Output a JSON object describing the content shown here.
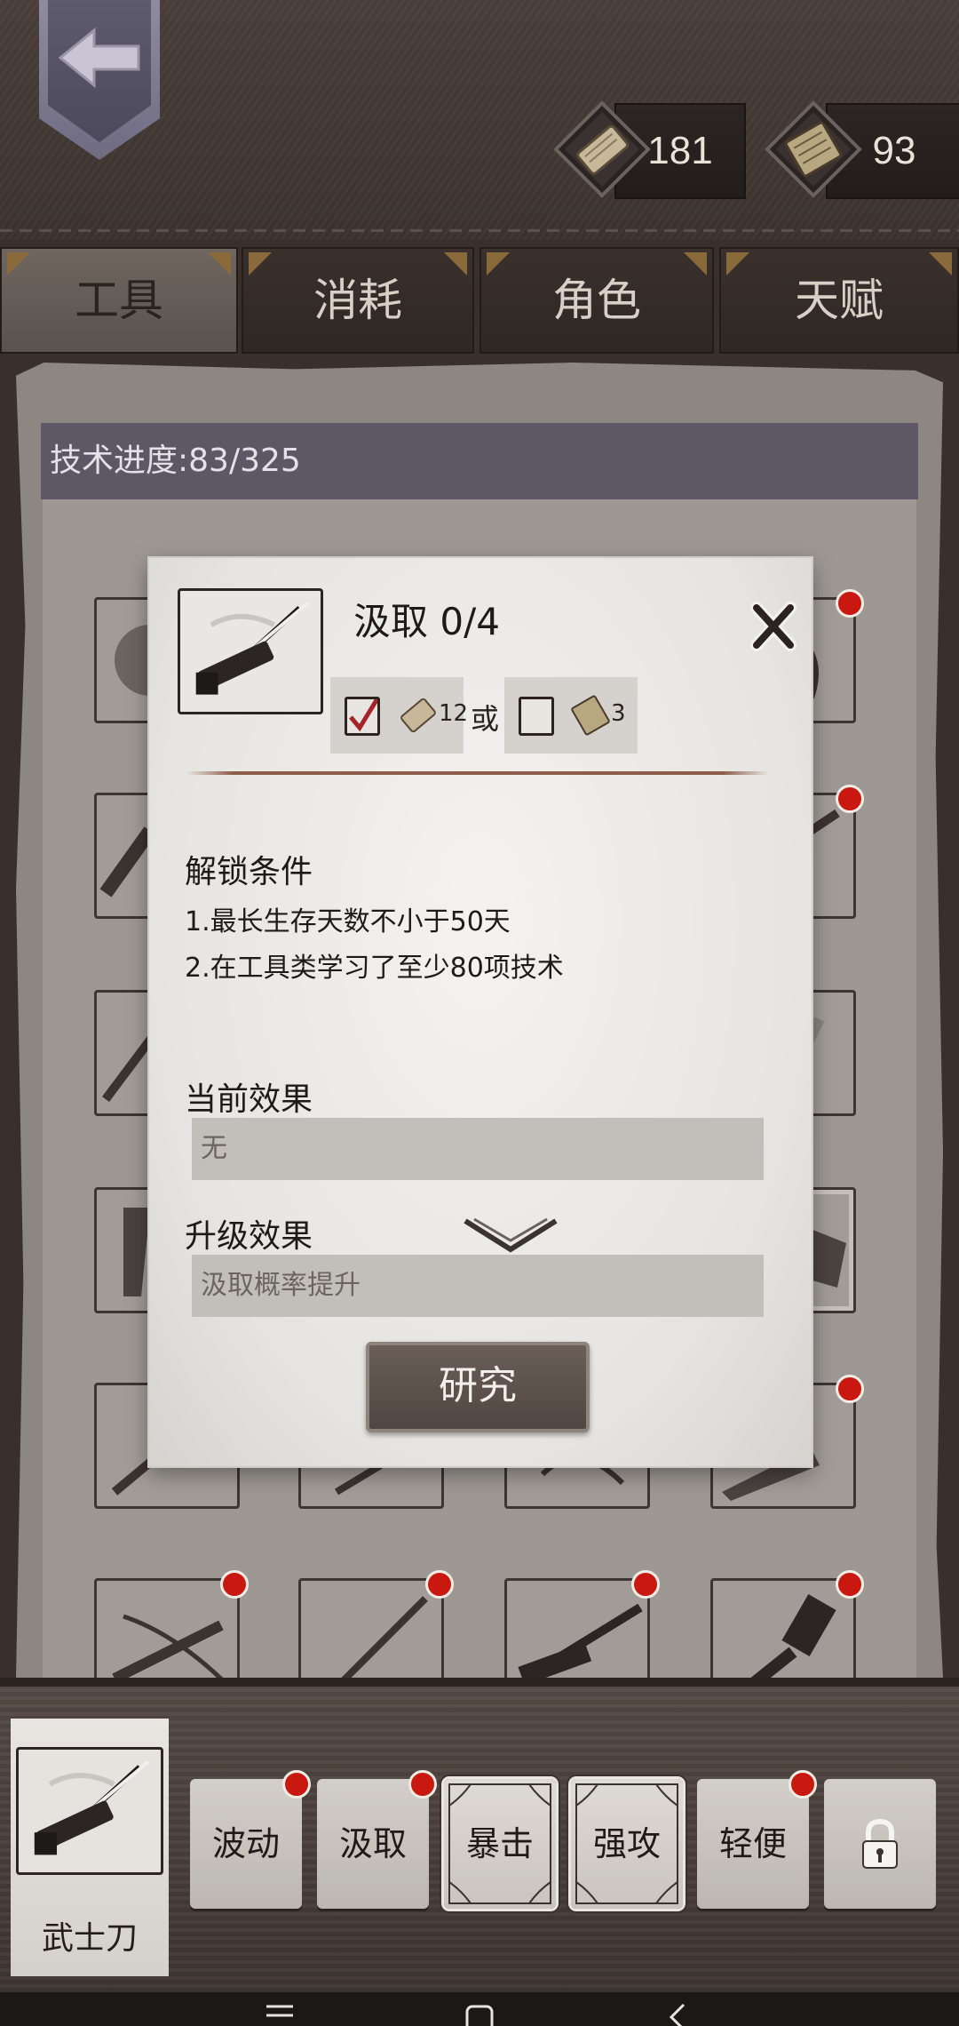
{
  "header": {
    "back_label": "back",
    "currency": [
      {
        "name": "scroll-icon",
        "value": "181"
      },
      {
        "name": "book-icon",
        "value": "93"
      }
    ]
  },
  "tabs": [
    {
      "label": "工具",
      "active": true
    },
    {
      "label": "消耗",
      "active": false
    },
    {
      "label": "角色",
      "active": false
    },
    {
      "label": "天赋",
      "active": false
    }
  ],
  "tech_progress": "技术进度:83/325",
  "dialog": {
    "title": "汲取 0/4",
    "cost_a": {
      "checked": true,
      "icon": "scroll-icon",
      "amount": "12"
    },
    "cost_or": "或",
    "cost_b": {
      "checked": false,
      "icon": "book-icon",
      "amount": "3"
    },
    "unlock_title": "解锁条件",
    "unlock_conditions": [
      "1.最长生存天数不小于50天",
      "2.在工具类学习了至少80项技术"
    ],
    "current_effect_title": "当前效果",
    "current_effect": "无",
    "upgrade_effect_title": "升级效果",
    "upgrade_effect": "汲取概率提升",
    "research_button": "研究"
  },
  "selected_item": {
    "label": "武士刀",
    "icon": "katana-icon"
  },
  "skills": [
    {
      "label": "波动",
      "badge": true,
      "framed": false
    },
    {
      "label": "汲取",
      "badge": true,
      "framed": false
    },
    {
      "label": "暴击",
      "badge": false,
      "framed": true
    },
    {
      "label": "强攻",
      "badge": false,
      "framed": true
    },
    {
      "label": "轻便",
      "badge": true,
      "framed": false
    },
    {
      "label": "",
      "badge": false,
      "framed": false,
      "icon": "lock-icon"
    }
  ],
  "colors": {
    "badge_red": "#c81810",
    "active_tab": "#6e665f",
    "tech_bar": "#5e5866"
  }
}
